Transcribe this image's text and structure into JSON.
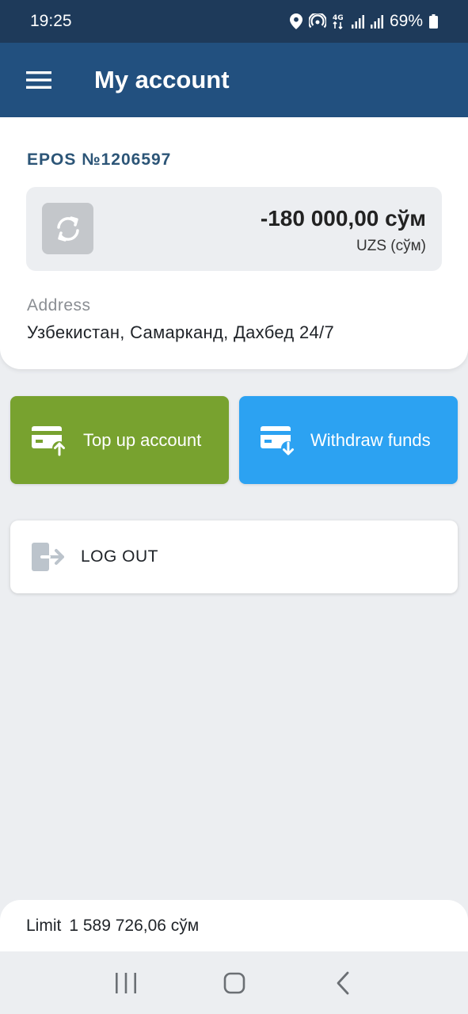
{
  "status_bar": {
    "time": "19:25",
    "network": "4G",
    "battery": "69%",
    "icons": [
      "location-icon",
      "hotspot-icon",
      "network-4g-icon",
      "signal-icon",
      "signal-icon",
      "battery-icon"
    ]
  },
  "app_bar": {
    "title": "My account",
    "menu_icon": "hamburger-menu-icon"
  },
  "account": {
    "epos": "EPOS №1206597",
    "balance": "-180 000,00 сўм",
    "currency": "UZS (сўм)",
    "refresh_icon": "refresh-icon",
    "address_label": "Address",
    "address_value": "Узбекистан, Самарканд, Дахбед 24/7"
  },
  "actions": {
    "top_up": {
      "label": "Top up account",
      "icon": "card-upload-icon",
      "color": "#78a22f"
    },
    "withdraw": {
      "label": "Withdraw funds",
      "icon": "card-download-icon",
      "color": "#2ca2f2"
    }
  },
  "logout": {
    "label": "LOG OUT",
    "icon": "logout-icon"
  },
  "limit": {
    "label": "Limit",
    "value": "1 589 726,06 сўм"
  },
  "nav": {
    "recents_icon": "recents-icon",
    "home_icon": "home-icon",
    "back_icon": "back-icon"
  },
  "colors": {
    "status_bar": "#1e3a5a",
    "app_bar": "#22507f",
    "background": "#eceef1"
  }
}
